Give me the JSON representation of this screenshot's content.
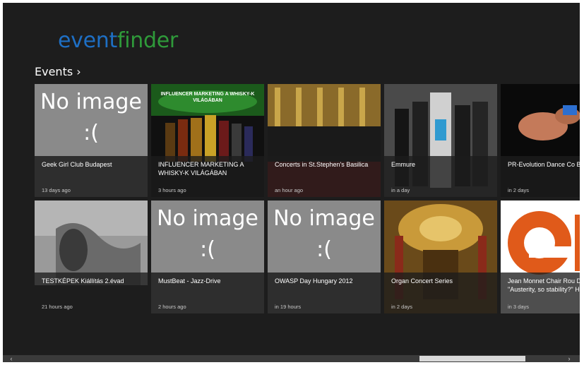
{
  "app": {
    "logo_part1": "event",
    "logo_part2": "finder"
  },
  "section": {
    "label": "Events",
    "chevron": "›"
  },
  "tiles": [
    {
      "title": "Geek Girl Club Budapest",
      "time": "13 days ago",
      "no_image": "No image\n:("
    },
    {
      "title": "INFLUENCER MARKETING A WHISKY-K VILÁGÁBAN",
      "time": "3 hours ago",
      "overlay": "INFLUENCER MARKETING A WHISKY-K VILÁGÁBAN"
    },
    {
      "title": "Concerts in St.Stephen's Basilica",
      "time": "an hour ago"
    },
    {
      "title": "Emmure",
      "time": "in a day"
    },
    {
      "title": "PR-Evolution Dance Co Blue Men",
      "time": "in 2 days"
    },
    {
      "title": "TESTKÉPEK Kiállítás 2.évad",
      "time": "21 hours ago"
    },
    {
      "title": "MustBeat - Jazz-Drive",
      "time": "2 hours ago",
      "no_image": "No image\n:("
    },
    {
      "title": "OWASP Day Hungary 2012",
      "time": "in 19 hours",
      "no_image": "No image\n:("
    },
    {
      "title": "Organ Concert Series",
      "time": "in 2 days"
    },
    {
      "title": "Jean Monnet Chair Rou Debate - \"Austerity, so stability?\" How economi",
      "time": "in 3 days"
    }
  ],
  "scrollbar": {
    "left_arrow": "‹",
    "right_arrow": "›"
  }
}
